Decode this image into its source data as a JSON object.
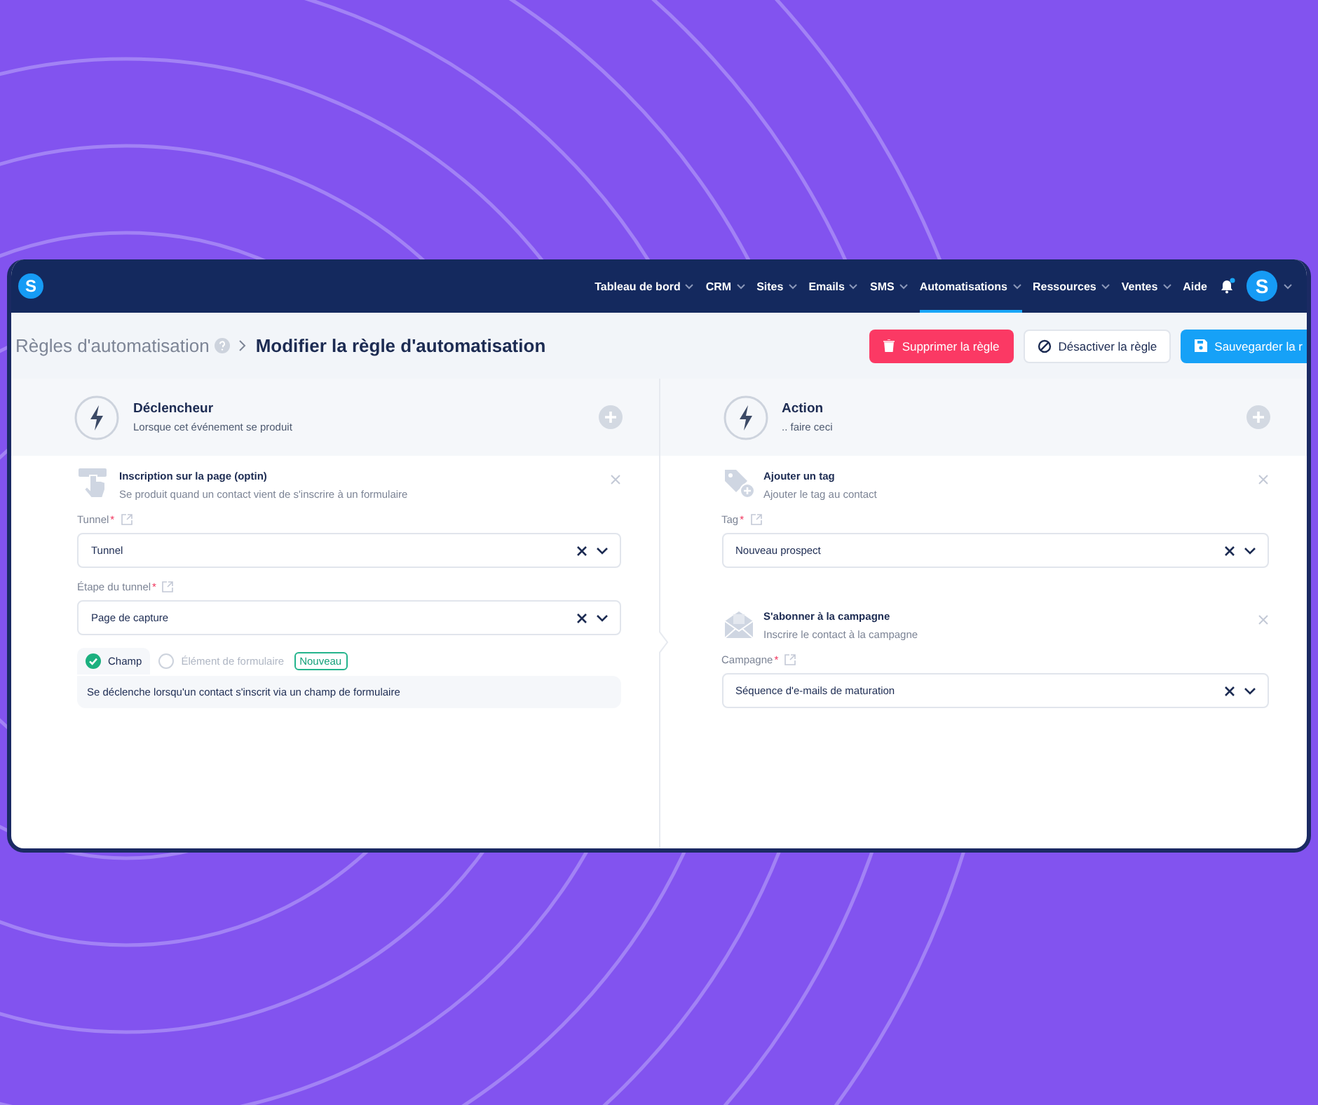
{
  "nav": {
    "logo": "S",
    "items": [
      {
        "label": "Tableau de bord",
        "selected": false
      },
      {
        "label": "CRM",
        "selected": false
      },
      {
        "label": "Sites",
        "selected": false
      },
      {
        "label": "Emails",
        "selected": false
      },
      {
        "label": "SMS",
        "selected": false
      },
      {
        "label": "Automatisations",
        "selected": true
      },
      {
        "label": "Ressources",
        "selected": false
      },
      {
        "label": "Ventes",
        "selected": false
      }
    ],
    "help": "Aide",
    "notification": true,
    "avatar": "S"
  },
  "breadcrumb": {
    "parent": "Règles d'automatisation",
    "current": "Modifier la règle d'automatisation"
  },
  "buttons": [
    {
      "label": "Supprimer la règle",
      "kind": "danger"
    },
    {
      "label": "Désactiver la règle",
      "kind": "outline"
    },
    {
      "label": "Sauvegarder la r",
      "kind": "primary"
    }
  ],
  "columns": [
    {
      "title": "Déclencheur",
      "subtitle": "Lorsque cet événement se produit",
      "steps": [
        {
          "kind": "optin",
          "title": "Inscription sur la page (optin)",
          "subtitle": "Se produit quand un contact vient de s'inscrire à un formulaire",
          "fields": [
            {
              "label": "Tunnel",
              "marker": "*",
              "value": "Tunnel"
            },
            {
              "label": "Étape du tunnel",
              "marker": "*",
              "value": "Page de capture"
            }
          ],
          "options": [
            {
              "label": "Champ",
              "selected": true
            },
            {
              "label": "Élément de formulaire",
              "selected": false,
              "badge": "Nouveau"
            }
          ],
          "note": "Se déclenche lorsqu'un contact s'inscrit via un champ de formulaire"
        }
      ]
    },
    {
      "title": "Action",
      "subtitle": ".. faire ceci",
      "steps": [
        {
          "kind": "tag",
          "title": "Ajouter un tag",
          "subtitle": "Ajouter le tag au contact",
          "fields": [
            {
              "label": "Tag",
              "marker": "*",
              "value": "Nouveau prospect"
            }
          ]
        },
        {
          "kind": "campaign",
          "title": "S'abonner à la campagne",
          "subtitle": "Inscrire le contact à la campagne",
          "fields": [
            {
              "label": "Campagne",
              "marker": "*",
              "value": "Séquence d'e-mails de maturation"
            }
          ]
        }
      ]
    }
  ]
}
